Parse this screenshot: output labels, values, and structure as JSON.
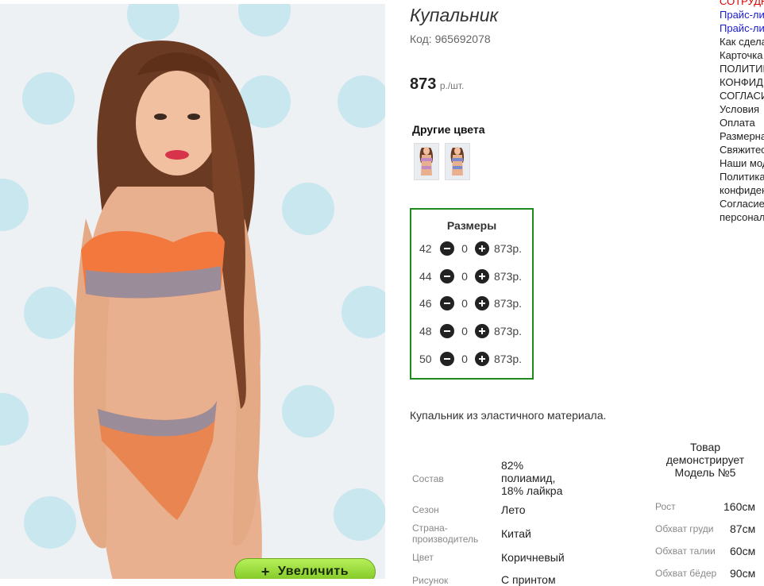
{
  "product": {
    "title": "Купальник",
    "code": "Код: 965692078",
    "price_value": "873",
    "price_unit": "р./шт.",
    "other_colors_title": "Другие цвета",
    "description": "Купальник из эластичного материала.",
    "zoom_button": "Увеличить",
    "zoom_plus": "+"
  },
  "sizes": {
    "title": "Размеры",
    "rows": [
      {
        "size": "42",
        "qty": "0",
        "price": "873р."
      },
      {
        "size": "44",
        "qty": "0",
        "price": "873р."
      },
      {
        "size": "46",
        "qty": "0",
        "price": "873р."
      },
      {
        "size": "48",
        "qty": "0",
        "price": "873р."
      },
      {
        "size": "50",
        "qty": "0",
        "price": "873р."
      }
    ]
  },
  "specs": [
    {
      "label": "Состав",
      "value": "82% полиамид, 18% лайкра"
    },
    {
      "label": "Сезон",
      "value": "Лето"
    },
    {
      "label": "Страна-производитель",
      "value": "Китай"
    },
    {
      "label": "Цвет",
      "value": "Коричневый"
    },
    {
      "label": "Рисунок",
      "value": "С принтом"
    }
  ],
  "model": {
    "title": "Товар демонстрирует Модель №5",
    "params": [
      {
        "label": "Рост",
        "value": "160см"
      },
      {
        "label": "Обхват груди",
        "value": "87см"
      },
      {
        "label": "Обхват талии",
        "value": "60см"
      },
      {
        "label": "Обхват бёдер",
        "value": "90см"
      }
    ]
  },
  "links": [
    {
      "text": "СОТРУДНИЧЕСТВО",
      "color": "red"
    },
    {
      "text": "Прайс-лист",
      "color": "blue"
    },
    {
      "text": "Прайс-лист",
      "color": "blue"
    },
    {
      "text": "Как сделать заказ",
      "color": "normal"
    },
    {
      "text": "Карточка",
      "color": "normal"
    },
    {
      "text": "ПОЛИТИКА",
      "color": "normal"
    },
    {
      "text": "КОНФИДЕНЦИАЛЬНОСТИ",
      "color": "normal"
    },
    {
      "text": "СОГЛАСИЕ",
      "color": "normal"
    },
    {
      "text": "Условия",
      "color": "normal"
    },
    {
      "text": "Оплата",
      "color": "normal"
    },
    {
      "text": "Размерная",
      "color": "normal"
    },
    {
      "text": "Свяжитесь",
      "color": "normal"
    },
    {
      "text": "Наши модели",
      "color": "normal"
    },
    {
      "text": "Политика",
      "color": "normal"
    },
    {
      "text": "конфиденциальности",
      "color": "normal"
    },
    {
      "text": "Согласие",
      "color": "normal"
    },
    {
      "text": "персональных",
      "color": "normal"
    }
  ],
  "colors": {
    "accent_green": "#1e8a1e",
    "link_blue": "#1a1ad0",
    "link_red": "#dd0000"
  }
}
